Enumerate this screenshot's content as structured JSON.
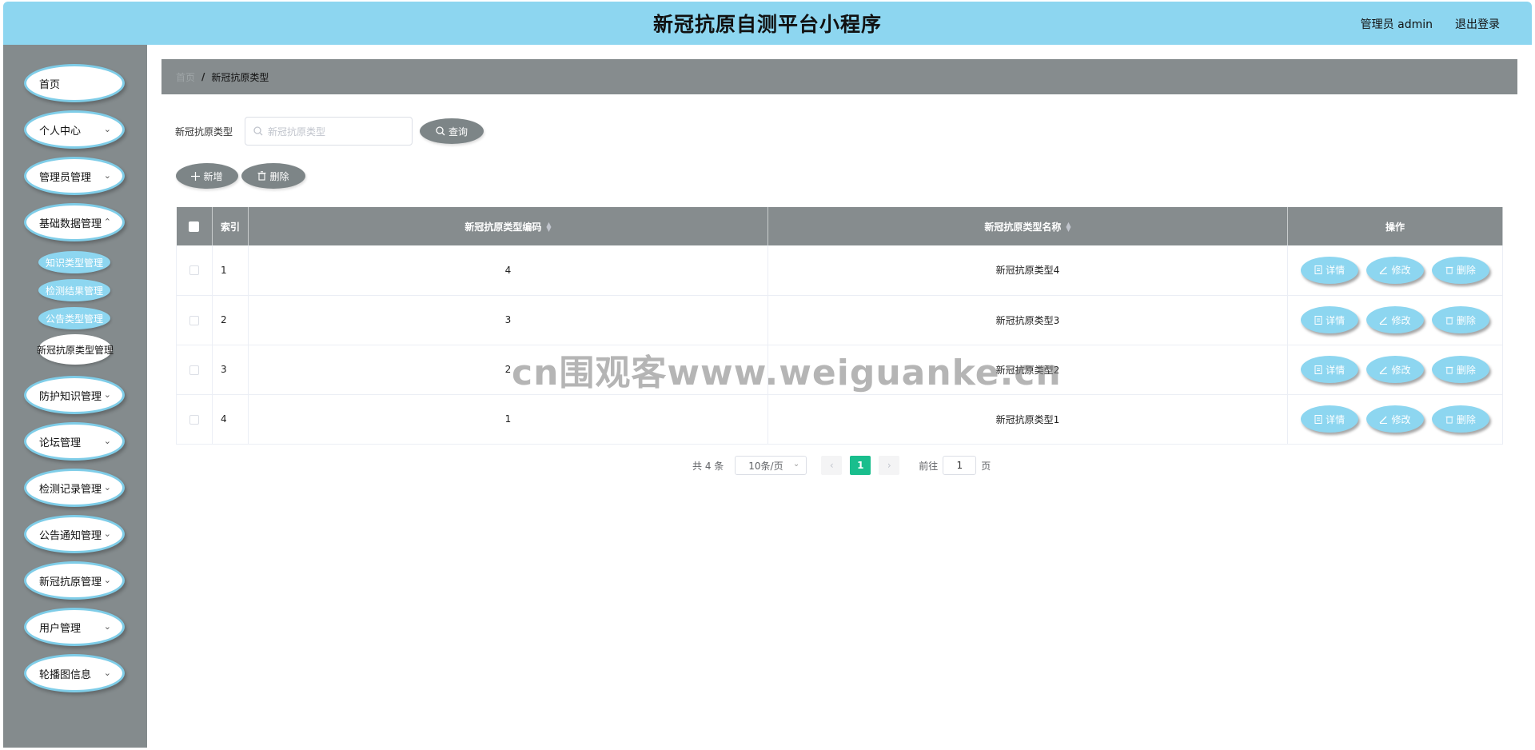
{
  "header": {
    "title": "新冠抗原自测平台小程序",
    "user": "管理员 admin",
    "logout": "退出登录"
  },
  "sidebar": {
    "items": [
      {
        "label": "首页"
      },
      {
        "label": "个人中心"
      },
      {
        "label": "管理员管理"
      },
      {
        "label": "基础数据管理"
      },
      {
        "label": "防护知识管理"
      },
      {
        "label": "论坛管理"
      },
      {
        "label": "检测记录管理"
      },
      {
        "label": "公告通知管理"
      },
      {
        "label": "新冠抗原管理"
      },
      {
        "label": "用户管理"
      },
      {
        "label": "轮播图信息"
      }
    ],
    "sub_items": [
      {
        "label": "知识类型管理"
      },
      {
        "label": "检测结果管理"
      },
      {
        "label": "公告类型管理"
      },
      {
        "label": "新冠抗原类型管理"
      }
    ]
  },
  "breadcrumb": {
    "home": "首页",
    "separator": "/",
    "current": "新冠抗原类型"
  },
  "search": {
    "label": "新冠抗原类型",
    "placeholder": "新冠抗原类型",
    "button": "查询"
  },
  "toolbar": {
    "add": "新增",
    "delete": "删除"
  },
  "table": {
    "headers": {
      "index": "索引",
      "code": "新冠抗原类型编码",
      "name": "新冠抗原类型名称",
      "ops": "操作"
    },
    "rows": [
      {
        "index": "1",
        "code": "4",
        "name": "新冠抗原类型4"
      },
      {
        "index": "2",
        "code": "3",
        "name": "新冠抗原类型3"
      },
      {
        "index": "3",
        "code": "2",
        "name": "新冠抗原类型2"
      },
      {
        "index": "4",
        "code": "1",
        "name": "新冠抗原类型1"
      }
    ],
    "op_labels": {
      "detail": "详情",
      "edit": "修改",
      "delete": "删除"
    }
  },
  "pagination": {
    "total": "共 4 条",
    "page_size": "10条/页",
    "current_page": "1",
    "goto_prefix": "前往",
    "goto_value": "1",
    "goto_suffix": "页"
  },
  "watermark": "cn围观客www.weiguanke.cn",
  "colors": {
    "header_bg": "#8dd6f0",
    "sidebar_bg": "#848b8d",
    "accent": "#8dd6f0",
    "page_active": "#19be8d"
  }
}
